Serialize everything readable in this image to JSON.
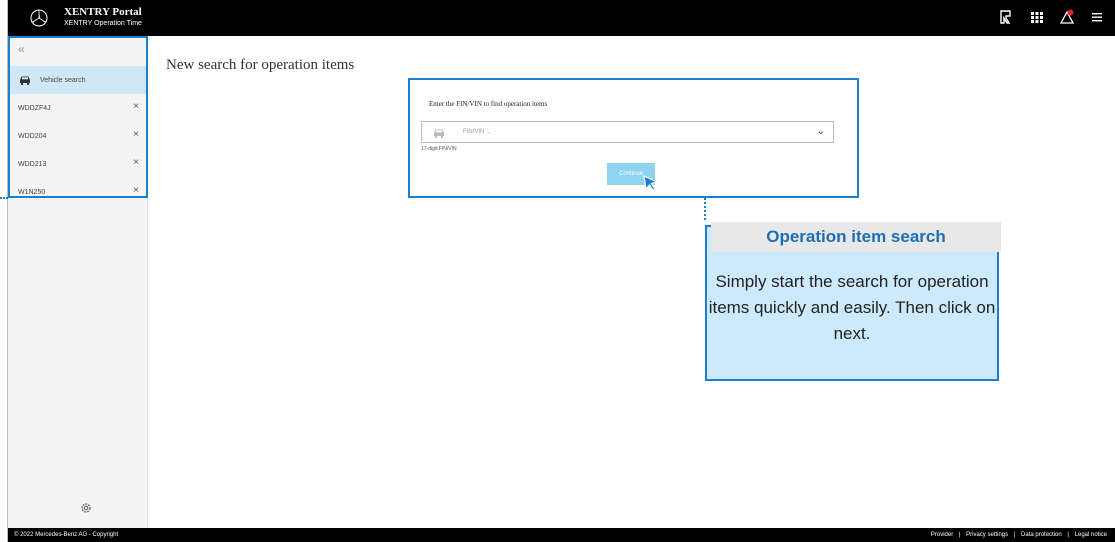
{
  "header": {
    "title": "XENTRY Portal",
    "subtitle": "XENTRY Operation Time"
  },
  "sidebar": {
    "collapse_symbol": "«",
    "items": [
      {
        "label": "Vehicle search",
        "active": true
      },
      {
        "label": "WDDZF4J",
        "closable": true
      },
      {
        "label": "WDD204",
        "closable": true
      },
      {
        "label": "WDD213",
        "closable": true
      },
      {
        "label": "W1N250",
        "closable": true
      }
    ],
    "close_symbol": "×"
  },
  "main": {
    "title": "New search for operation items",
    "search": {
      "label": "Enter the FIN/VIN to find operation items",
      "placeholder": "FIN/VIN ...",
      "help": "17-digit FIN/VIN",
      "continue_label": "Continue"
    }
  },
  "callout": {
    "title": "Operation item search",
    "text": "Simply start the search for operation items quickly and easily. Then click on next."
  },
  "footer": {
    "copyright": "© 2022 Mercedes-Benz AG - Copyright",
    "links": [
      "Provider",
      "Privacy settings",
      "Data protection",
      "Legal notice"
    ],
    "separator": "|"
  },
  "colors": {
    "accent": "#1b7fd0",
    "callout_bg": "#cdeafc",
    "active_item": "#cfe8f5",
    "button": "#8fd3f0"
  },
  "icons": [
    "mercedes-star-icon",
    "report-icon",
    "grid-icon",
    "alert-icon",
    "menu-icon",
    "car-icon",
    "settings-icon",
    "chevron-down-icon",
    "close-icon",
    "cursor-icon"
  ]
}
